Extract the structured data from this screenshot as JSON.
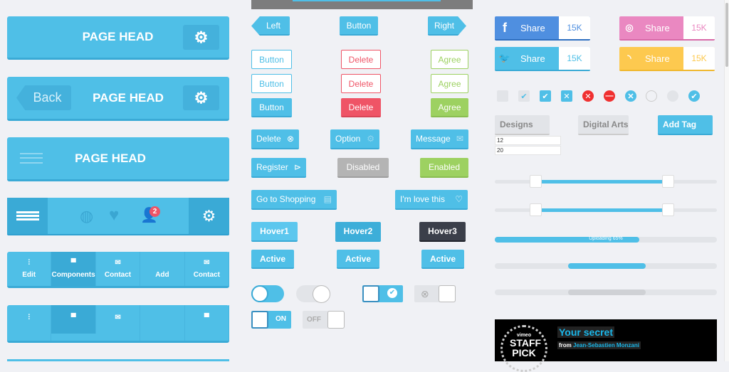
{
  "headers": {
    "title": "PAGE HEAD",
    "back": "Back",
    "badge": "2"
  },
  "tabbar": [
    {
      "label": "Edit",
      "icon": "sliders-icon"
    },
    {
      "label": "Components",
      "icon": "chat-icon"
    },
    {
      "label": "Contact",
      "icon": "mail-icon"
    },
    {
      "label": "Add",
      "icon": ""
    },
    {
      "label": "Contact",
      "icon": "mail-icon"
    }
  ],
  "nav": {
    "left": "Left",
    "button": "Button",
    "right": "Right"
  },
  "outline": {
    "button": "Button",
    "delete": "Delete",
    "agree": "Agree"
  },
  "icon_buttons": {
    "delete": "Delete",
    "option": "Option",
    "message": "Message",
    "register": "Register",
    "disabled": "Disabled",
    "enabled": "Enabled",
    "shopping": "Go to Shopping",
    "love": "I'm love this"
  },
  "hover": [
    "Hover1",
    "Hover2",
    "Hover3"
  ],
  "active": "Active",
  "toggles": {
    "on": "ON",
    "off": "OFF"
  },
  "share": {
    "label": "Share",
    "count": "15K",
    "colors": {
      "facebook": "#4f8fe0",
      "dribbble": "#ea88c1",
      "twitter": "#4fbfe7",
      "rss": "#fdc94f"
    }
  },
  "tags": {
    "designs": "Designs",
    "digital": "Digital Arts",
    "add": "Add Tag"
  },
  "inputs": [
    "12",
    "20"
  ],
  "progress": {
    "label": "Uploading 65%",
    "value": 65
  },
  "vimeo": {
    "title": "Your secret",
    "from": "from",
    "author": "Jean-Sebastien Monzani",
    "badge_top": "vimeo",
    "badge": "STAFF PICK"
  },
  "colors": {
    "accent": "#4fbfe7",
    "danger": "#ef5466",
    "success": "#9dd161",
    "dark": "#3b3f4a"
  }
}
